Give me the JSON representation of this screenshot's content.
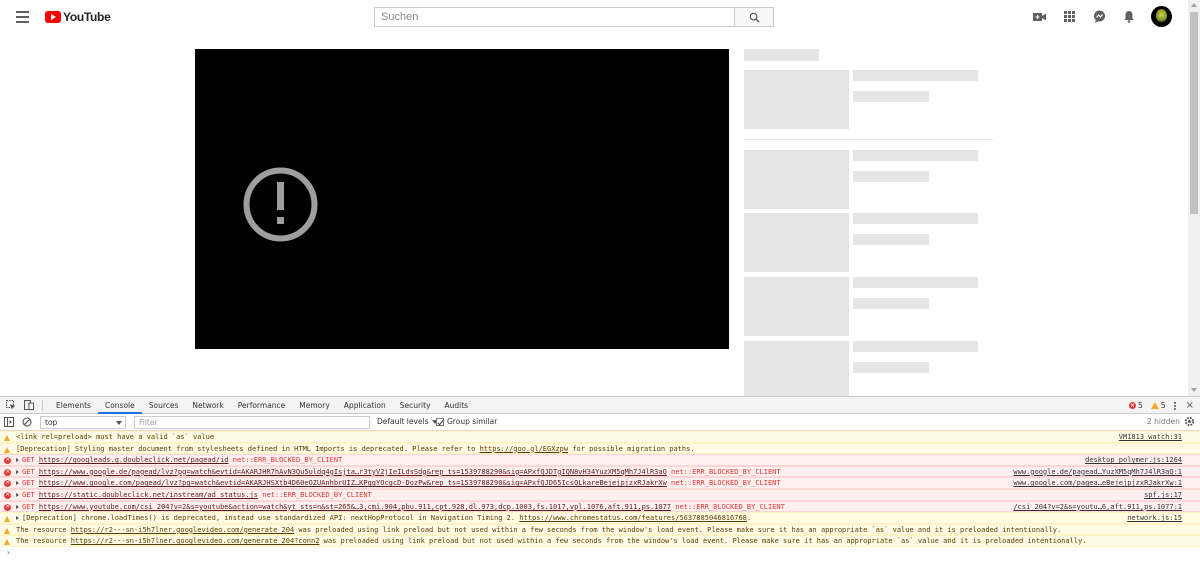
{
  "header": {
    "logo_text": "YouTube",
    "search_placeholder": "Suchen"
  },
  "devtools": {
    "tabs": [
      "Elements",
      "Console",
      "Sources",
      "Network",
      "Performance",
      "Memory",
      "Application",
      "Security",
      "Audits"
    ],
    "active_tab": "Console",
    "error_count": "5",
    "warning_count": "5",
    "context": "top",
    "filter_placeholder": "Filter",
    "levels_label": "Default levels",
    "group_similar_label": "Group similar",
    "hidden_label": "2 hidden"
  },
  "console": {
    "messages": [
      {
        "level": "warn",
        "text": "<link rel=preload> must have a valid `as` value",
        "source": "VM1813 watch:31"
      },
      {
        "level": "warn",
        "pre": "[Deprecation] Styling master document from stylesheets defined in HTML Imports is deprecated. Please refer to ",
        "link": "https://goo.gl/EGXzpw",
        "post": " for possible migration paths.",
        "source": ""
      },
      {
        "level": "error",
        "method": "GET",
        "link": "https://googleads.g.doubleclick.net/pagead/id",
        "post": " net::ERR_BLOCKED_BY_CLIENT",
        "source": "desktop_polymer.js:1264"
      },
      {
        "level": "error",
        "method": "GET",
        "link": "https://www.google.de/pagead/lvz?pg=watch&evtid=AKARJHR7hAvN3Qu5uldq4gIsjta…r3tyV2jIeILdsSdg&rep_ts=1539788290&sig=APxfQJDTgIQN8vH34YuzXM5qMh7J4lR3aQ",
        "post": " net::ERR_BLOCKED_BY_CLIENT",
        "source": "www.google.de/pagead…YuzXM5qMh7J4lR3aQ:1"
      },
      {
        "level": "error",
        "method": "GET",
        "link": "https://www.google.com/pagead/lvz?pg=watch&evtid=AKARJHSXtb4D60eOZUAnhbrUIZ…KPggYOcgcD-DozPw&rep_ts=1539788290&sig=APxfQJD65IcsQLkareBejejpjzxRJakrXw",
        "post": " net::ERR_BLOCKED_BY_CLIENT",
        "source": "www.google.com/pagea…eBejejpjzxRJakrXw:1"
      },
      {
        "level": "error",
        "method": "GET",
        "link": "https://static.doubleclick.net/instream/ad_status.js",
        "post": " net::ERR_BLOCKED_BY_CLIENT",
        "source": "spf.js:17"
      },
      {
        "level": "error",
        "method": "GET",
        "link": "https://www.youtube.com/csi_204?v=2&s=youtube&action=watch&yt_sts=n&st=265&…3,cmi.904,pbu.911,cpt.928,dl.973,dcp.1003,fs.1017,vpl.1076,aft.911,ps.1077",
        "post": " net::ERR_BLOCKED_BY_CLIENT",
        "source": "/csi_204?v=2&s=youtu…6,aft.911,ps.1077:1"
      },
      {
        "level": "warn",
        "expand": true,
        "pre": "[Deprecation] chrome.loadTimes() is deprecated, instead use standardized API: nextHopProtocol in Navigation Timing 2. ",
        "link": "https://www.chromestatus.com/features/5637885046816768",
        "post": ".",
        "source": "network.js:15"
      },
      {
        "level": "warn",
        "pre": "The resource ",
        "link": "https://r2---sn-i5h7lner.googlevideo.com/generate_204",
        "post": " was preloaded using link preload but not used within a few seconds from the window's load event. Please make sure it has an appropriate `as` value and it is preloaded intentionally.",
        "source": ""
      },
      {
        "level": "warn",
        "pre": "The resource ",
        "link": "https://r2---sn-i5h7lner.googlevideo.com/generate_204?conn2",
        "post": " was preloaded using link preload but not used within a few seconds from the window's load event. Please make sure it has an appropriate `as` value and it is preloaded intentionally.",
        "source": ""
      }
    ],
    "prompt_glyph": "›"
  },
  "colors": {
    "accent": "#1a73e8",
    "error": "#e53935",
    "warning": "#f9a825",
    "brand": "#ff0000"
  }
}
